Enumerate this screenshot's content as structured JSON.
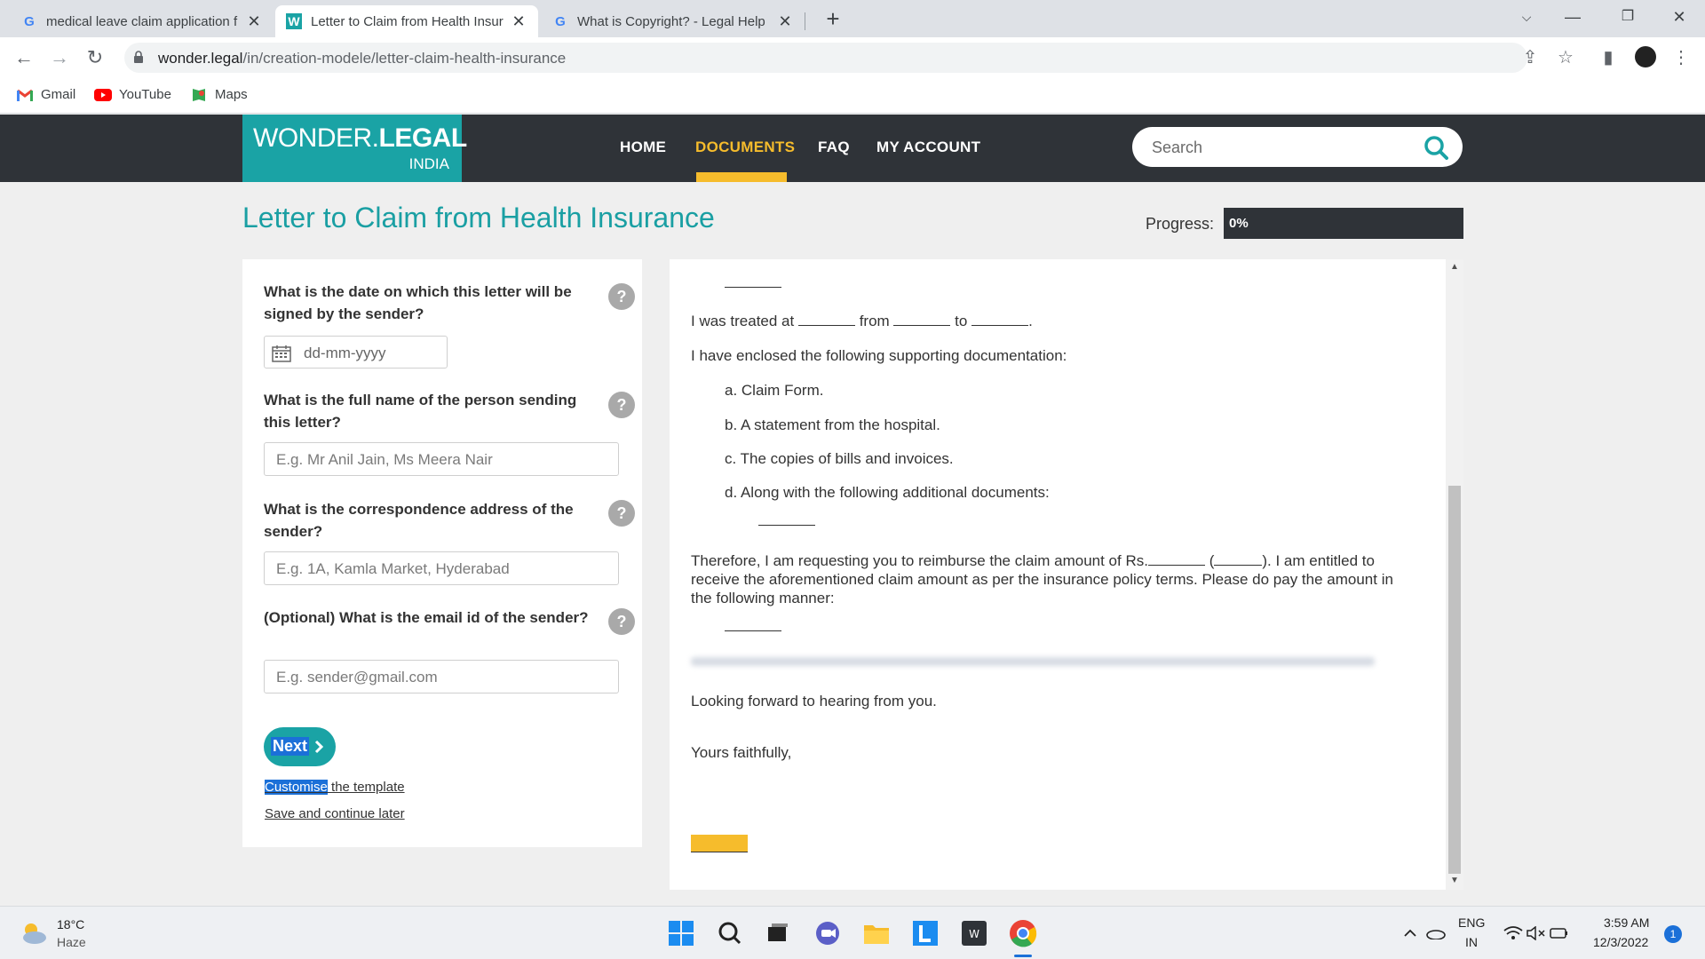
{
  "browser": {
    "tabs": [
      {
        "title": "medical leave claim application f",
        "favicon": "G",
        "active": false
      },
      {
        "title": "Letter to Claim from Health Insur",
        "favicon": "W",
        "active": true
      },
      {
        "title": "What is Copyright? - Legal Help",
        "favicon": "G",
        "active": false
      }
    ],
    "url_host": "wonder.legal",
    "url_path": "/in/creation-modele/letter-claim-health-insurance",
    "bookmarks": [
      "Gmail",
      "YouTube",
      "Maps"
    ]
  },
  "site": {
    "logo_main": "WONDER.",
    "logo_bold": "LEGAL",
    "logo_sub": "INDIA",
    "menu": [
      "HOME",
      "DOCUMENTS",
      "FAQ",
      "MY ACCOUNT"
    ],
    "active_menu": "DOCUMENTS",
    "search_placeholder": "Search",
    "accent_color": "#1aa3a5",
    "highlight_color": "#f6bc2c"
  },
  "page": {
    "title": "Letter to Claim from Health Insurance",
    "progress_label": "Progress:",
    "progress_value": "0%",
    "progress_fraction": 0
  },
  "form": {
    "q1": "What is the date on which this letter will be signed by the sender?",
    "q1_placeholder": "dd-mm-yyyy",
    "q2": "What is the full name of the person sending this letter?",
    "q2_placeholder": "E.g. Mr Anil Jain, Ms Meera Nair",
    "q3": "What is the correspondence address of the sender?",
    "q3_placeholder": "E.g. 1A, Kamla Market, Hyderabad",
    "q4": "(Optional) What is the email id of the sender?",
    "q4_placeholder": "E.g. sender@gmail.com",
    "help": "?",
    "next": "Next",
    "customise_selected": "Customise",
    "customise_rest": " the template",
    "save_later": "Save and continue later"
  },
  "preview": {
    "treated_1": "I was treated at",
    "treated_2": "from",
    "treated_3": "to",
    "treated_4": ".",
    "enclosed": "I have enclosed the following supporting documentation:",
    "item_a": "a. Claim Form.",
    "item_b": "b. A statement from the hospital.",
    "item_c": "c. The copies of bills and invoices.",
    "item_d": "d. Along with the following additional documents:",
    "therefore_1": "Therefore, I am requesting you to reimburse the claim amount of Rs.",
    "therefore_2": "(",
    "therefore_3": "). I am entitled to",
    "therefore_line2": "receive the aforementioned claim amount as per the insurance policy terms. Please do pay the amount in",
    "therefore_line3": "the following manner:",
    "looking": "Looking forward to hearing from you.",
    "yours": "Yours faithfully,"
  },
  "taskbar": {
    "temp": "18°C",
    "weather": "Haze",
    "lang1": "ENG",
    "lang2": "IN",
    "time": "3:59 AM",
    "date": "12/3/2022",
    "notifications": "1"
  }
}
